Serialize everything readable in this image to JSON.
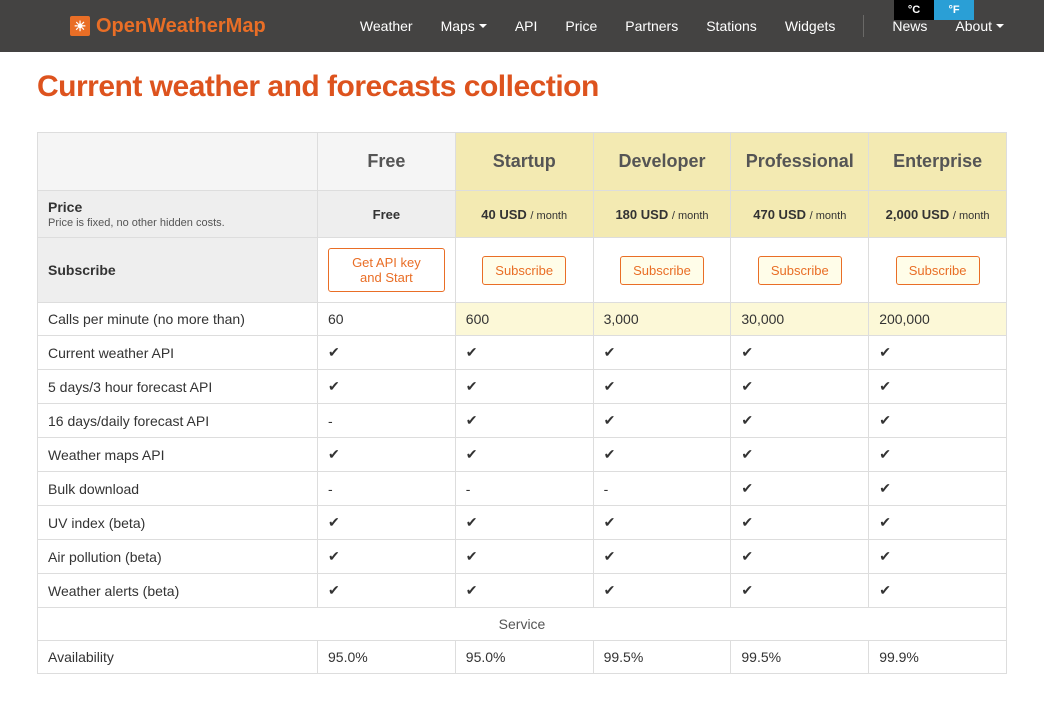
{
  "brand": "OpenWeatherMap",
  "nav": [
    "Weather",
    "Maps",
    "API",
    "Price",
    "Partners",
    "Stations",
    "Widgets",
    "News",
    "About"
  ],
  "units": {
    "c": "°C",
    "f": "°F"
  },
  "page_title": "Current weather and forecasts collection",
  "plans": {
    "names": [
      "Free",
      "Startup",
      "Developer",
      "Professional",
      "Enterprise"
    ],
    "price_label": "Price",
    "price_sub": "Price is fixed, no other hidden costs.",
    "prices": [
      "Free",
      "40 USD",
      "180 USD",
      "470 USD",
      "2,000 USD"
    ],
    "per_month": "/ month",
    "subscribe_label": "Subscribe",
    "subscribe_buttons": [
      "Get API key and Start",
      "Subscribe",
      "Subscribe",
      "Subscribe",
      "Subscribe"
    ],
    "calls_label": "Calls per minute (no more than)",
    "calls": [
      "60",
      "600",
      "3,000",
      "30,000",
      "200,000"
    ]
  },
  "features": [
    {
      "label": "Current weather API",
      "vals": [
        "✔",
        "✔",
        "✔",
        "✔",
        "✔"
      ]
    },
    {
      "label": "5 days/3 hour forecast API",
      "vals": [
        "✔",
        "✔",
        "✔",
        "✔",
        "✔"
      ]
    },
    {
      "label": "16 days/daily forecast API",
      "vals": [
        "-",
        "✔",
        "✔",
        "✔",
        "✔"
      ]
    },
    {
      "label": "Weather maps API",
      "vals": [
        "✔",
        "✔",
        "✔",
        "✔",
        "✔"
      ]
    },
    {
      "label": "Bulk download",
      "vals": [
        "-",
        "-",
        "-",
        "✔",
        "✔"
      ]
    },
    {
      "label": "UV index (beta)",
      "vals": [
        "✔",
        "✔",
        "✔",
        "✔",
        "✔"
      ]
    },
    {
      "label": "Air pollution (beta)",
      "vals": [
        "✔",
        "✔",
        "✔",
        "✔",
        "✔"
      ]
    },
    {
      "label": "Weather alerts (beta)",
      "vals": [
        "✔",
        "✔",
        "✔",
        "✔",
        "✔"
      ]
    }
  ],
  "service_label": "Service",
  "availability": {
    "label": "Availability",
    "vals": [
      "95.0%",
      "95.0%",
      "99.5%",
      "99.5%",
      "99.9%"
    ]
  }
}
